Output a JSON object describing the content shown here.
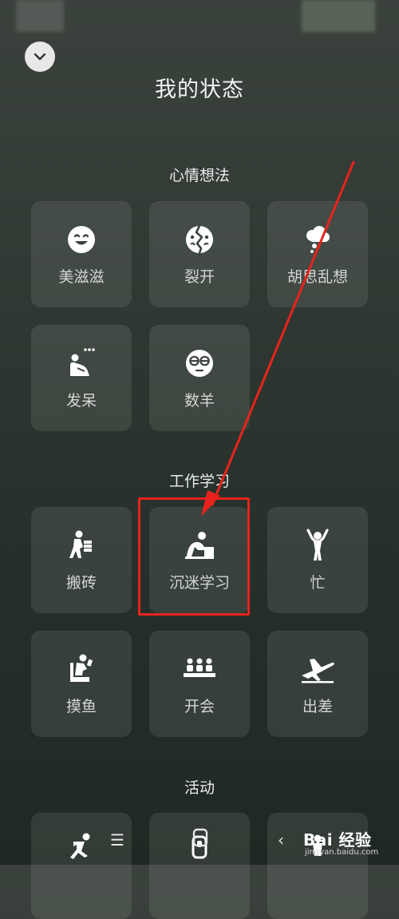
{
  "header": {
    "title": "我的状态",
    "collapse_icon": "chevron-down-icon"
  },
  "sections": [
    {
      "title": "心情想法",
      "items": [
        {
          "label": "美滋滋",
          "icon": "smile-face-icon"
        },
        {
          "label": "裂开",
          "icon": "cracked-face-icon"
        },
        {
          "label": "胡思乱想",
          "icon": "thought-cloud-icon"
        },
        {
          "label": "发呆",
          "icon": "daydream-person-icon"
        },
        {
          "label": "数羊",
          "icon": "sleepy-face-icon"
        }
      ]
    },
    {
      "title": "工作学习",
      "items": [
        {
          "label": "搬砖",
          "icon": "carry-bricks-icon"
        },
        {
          "label": "沉迷学习",
          "icon": "studying-person-icon"
        },
        {
          "label": "忙",
          "icon": "busy-person-icon"
        },
        {
          "label": "摸鱼",
          "icon": "slacking-person-icon"
        },
        {
          "label": "开会",
          "icon": "meeting-icon"
        },
        {
          "label": "出差",
          "icon": "airplane-icon"
        }
      ]
    },
    {
      "title": "活动",
      "items": [
        {
          "label": "",
          "icon": "running-person-icon"
        },
        {
          "label": "",
          "icon": "peace-hand-icon"
        },
        {
          "label": "",
          "icon": "activity-icon"
        }
      ]
    }
  ],
  "annotation": {
    "highlight_color": "#e8231c",
    "highlighted_item": "沉迷学习"
  },
  "nav": {
    "menu_icon": "menu-icon",
    "home_icon": "home-icon",
    "back_icon": "back-icon"
  },
  "watermark": {
    "brand": "Bai 经验",
    "site": "jingyan.baidu.com"
  }
}
